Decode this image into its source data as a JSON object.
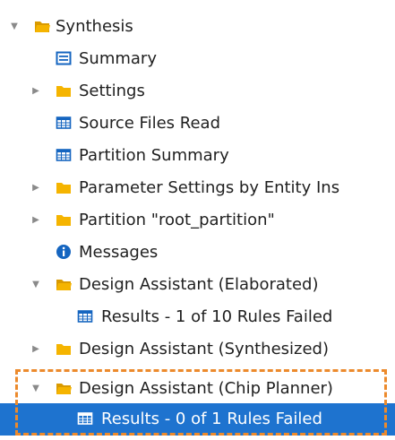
{
  "tree": {
    "synthesis": {
      "label": "Synthesis",
      "icon": "folder-open-icon",
      "expanded": true
    },
    "summary": {
      "label": "Summary",
      "icon": "summary-icon"
    },
    "settings": {
      "label": "Settings",
      "icon": "folder-icon",
      "expanded": false
    },
    "source_files_read": {
      "label": "Source Files Read",
      "icon": "table-icon"
    },
    "partition_summary": {
      "label": "Partition Summary",
      "icon": "table-icon"
    },
    "parameter_settings": {
      "label": "Parameter Settings by Entity Ins",
      "icon": "folder-icon",
      "expanded": false
    },
    "partition_root": {
      "label": "Partition \"root_partition\"",
      "icon": "folder-icon",
      "expanded": false
    },
    "messages": {
      "label": "Messages",
      "icon": "info-icon"
    },
    "da_elaborated": {
      "label": "Design Assistant (Elaborated)",
      "icon": "folder-open-icon",
      "expanded": true
    },
    "da_elaborated_results": {
      "label": "Results - 1 of 10 Rules Failed",
      "icon": "table-icon"
    },
    "da_synthesized": {
      "label": "Design Assistant (Synthesized)",
      "icon": "folder-icon",
      "expanded": false
    },
    "da_chip_planner": {
      "label": "Design Assistant (Chip Planner)",
      "icon": "folder-open-icon",
      "expanded": true
    },
    "da_chip_planner_results": {
      "label": "Results - 0 of 1 Rules Failed",
      "icon": "table-icon",
      "selected": true
    }
  },
  "colors": {
    "folder": "#f5b400",
    "icon_blue": "#1565c0",
    "selection": "#1e73cf",
    "highlight_border": "#ec8a2c"
  }
}
